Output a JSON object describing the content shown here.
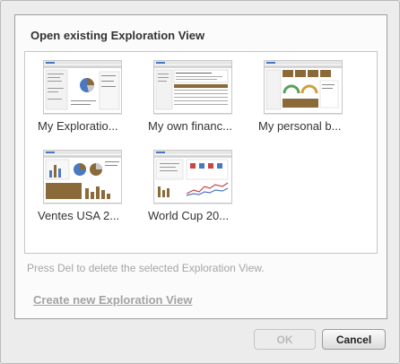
{
  "dialog": {
    "title": "Open existing Exploration View",
    "hint": "Press Del to delete the selected Exploration View.",
    "create_link": "Create new Exploration View",
    "ok_label": "OK",
    "cancel_label": "Cancel"
  },
  "views": [
    {
      "label": "My Exploratio...",
      "thumbnail": "pie-dashboard-thumbnail"
    },
    {
      "label": "My own financ...",
      "thumbnail": "table-dashboard-thumbnail"
    },
    {
      "label": "My personal b...",
      "thumbnail": "gauge-dashboard-thumbnail"
    },
    {
      "label": "Ventes USA 2...",
      "thumbnail": "pie-bar-dashboard-thumbnail"
    },
    {
      "label": "World Cup 20...",
      "thumbnail": "line-dashboard-thumbnail"
    }
  ],
  "colors": {
    "brand_brown": "#8b6a3a",
    "accent_blue": "#4a79c2",
    "disabled_text": "#a5a5a5"
  }
}
